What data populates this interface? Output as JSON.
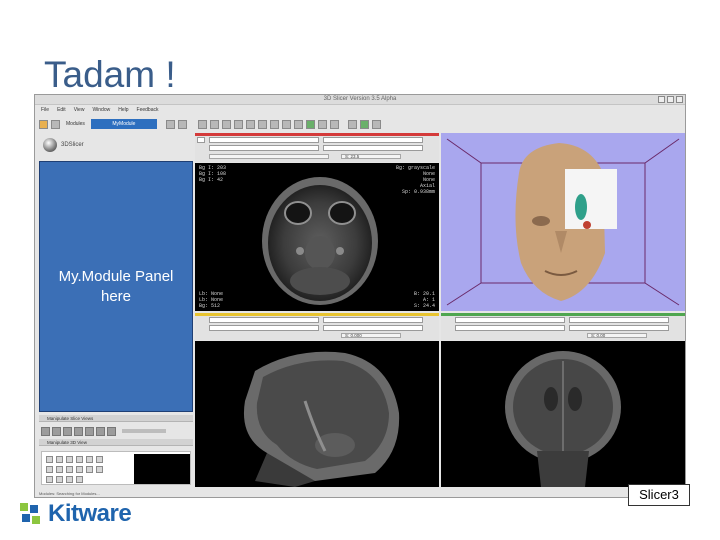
{
  "slide": {
    "title": "Tadam !"
  },
  "app": {
    "window_title": "3D Slicer Version 3.5 Alpha",
    "menu": [
      "File",
      "Edit",
      "View",
      "Window",
      "Help",
      "Feedback"
    ],
    "toolbar": {
      "modules_label": "Modules",
      "module_selected": "MyModule"
    },
    "logo_text": "3DSlicer",
    "module_panel_text": "My.Module Panel here",
    "collapsible": [
      "Manipulate Slice Views",
      "Manipulate 3D View"
    ],
    "status_text": "Modules: Searching for Modules..."
  },
  "viewers": {
    "red": {
      "color": "#d43a3a",
      "offset": "S: 23.5",
      "annot_tl": [
        "Bg I: 203",
        "Bg I: 108",
        "Bg I: 42"
      ],
      "annot_tr": [
        "Bg: grayscale",
        "None",
        "None",
        "",
        "Axial",
        "Sp: 0.938mm"
      ],
      "annot_bl": [
        "Lb: None",
        "Lb: None",
        "Bg: 512"
      ],
      "annot_br": [
        "B: 20.1",
        "A: 1",
        "S: 24.4"
      ]
    },
    "yellow": {
      "color": "#e8c430",
      "offset": "S: 0.000"
    },
    "green": {
      "color": "#4fa64f",
      "offset": "S: 0.00"
    },
    "three_d": {
      "background": "#a9a7ee"
    }
  },
  "badge": "Slicer3",
  "footer_logo": "Kitware",
  "colors": {
    "title": "#3a5d8a",
    "panel": "#3b6fb6",
    "kitware": "#1f64ad"
  }
}
